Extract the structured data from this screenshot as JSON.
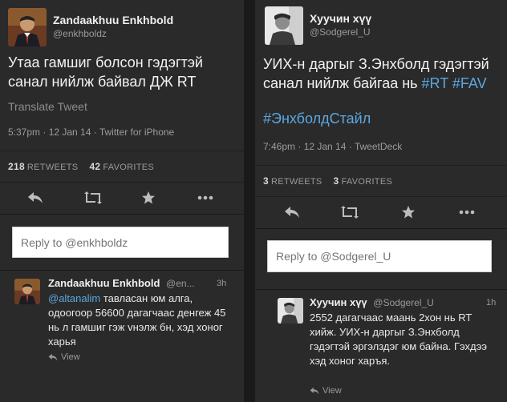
{
  "left": {
    "author": {
      "fullname": "Zandaakhuu Enkhbold",
      "screenname": "@enkhboldz"
    },
    "tweet": {
      "text": "Утаа гамшиг болсон гэдэгтэй санал нийлж байвал ДЖ RT"
    },
    "translate_label": "Translate Tweet",
    "meta": "5:37pm · 12 Jan 14 · Twitter for iPhone",
    "stats": {
      "retweets_count": "218",
      "retweets_label": "RETWEETS",
      "favorites_count": "42",
      "favorites_label": "FAVORITES"
    },
    "reply_placeholder": "Reply to @enkhboldz",
    "reply": {
      "fullname": "Zandaakhuu Enkhbold",
      "screenname": "@en...",
      "time": "3h",
      "mention": "@altanalim",
      "text": " тавласан юм алга, одоогоор 56600 дагагчаас денгеж 45 нь л гамшиг гэж vнэлж бн, хэд хоног харья",
      "view_label": "View"
    }
  },
  "right": {
    "author": {
      "fullname": "Хуучин хүү",
      "screenname": "@Sodgerel_U"
    },
    "tweet": {
      "text": "УИХ-н даргыг З.Энхболд гэдэгтэй санал нийлж байгаа нь ",
      "hashtag1": "#RT",
      "hashtag2": "#FAV",
      "hashtag3": "#ЭнхболдСтайл"
    },
    "meta": "7:46pm · 12 Jan 14 · TweetDeck",
    "stats": {
      "retweets_count": "3",
      "retweets_label": "RETWEETS",
      "favorites_count": "3",
      "favorites_label": "FAVORITES"
    },
    "reply_placeholder": "Reply to @Sodgerel_U",
    "reply": {
      "fullname": "Хуучин хүү",
      "screenname": "@Sodgerel_U",
      "time": "1h",
      "text": "2552 дагагчаас маань 2хон нь RT хийж. УИХ-н даргыг З.Энхболд гэдэгтэй эргэлздэг юм байна. Гэхдээ хэд хоног харъя.",
      "view_label": "View"
    }
  },
  "colors": {
    "link": "#5aa7e0",
    "panel_bg": "#2a2a2a",
    "gutter_bg": "#1a1a1a"
  }
}
